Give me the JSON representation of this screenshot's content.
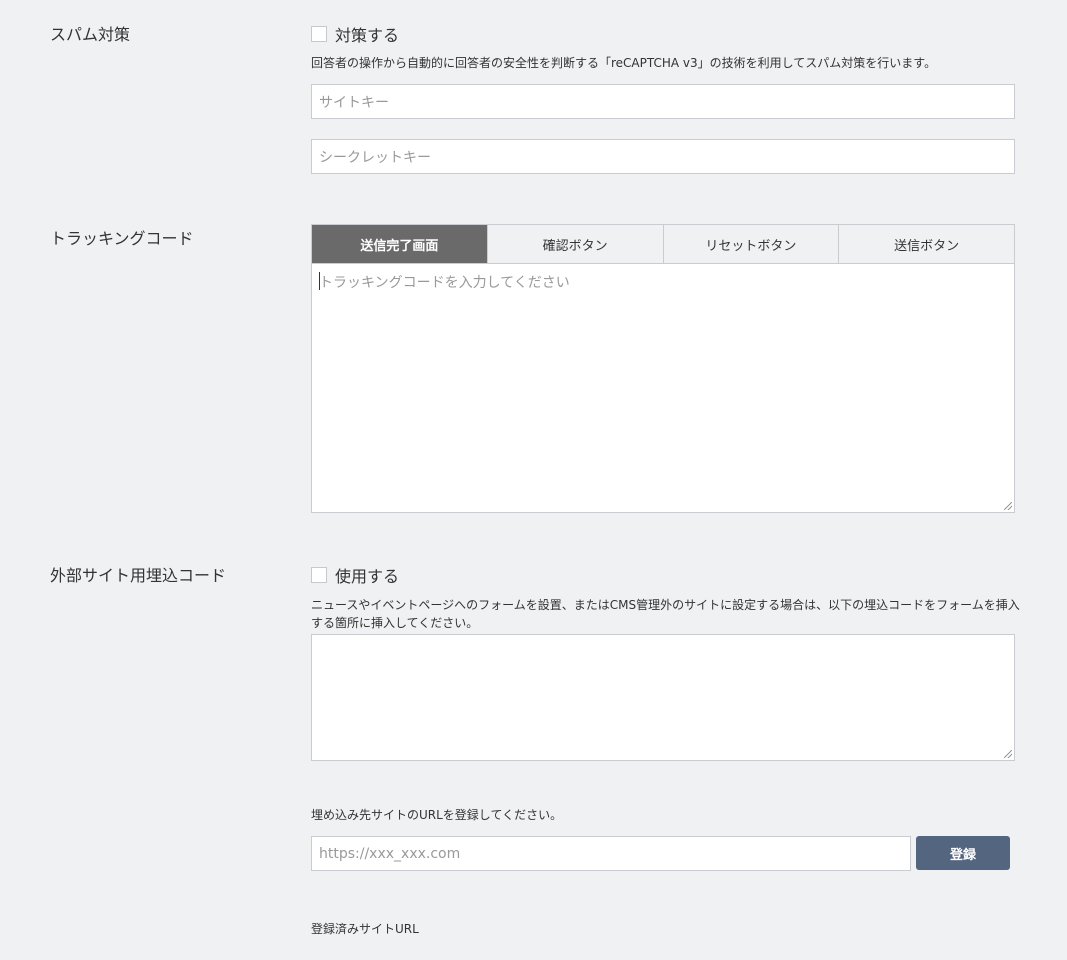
{
  "spam": {
    "label": "スパム対策",
    "checkbox_label": "対策する",
    "description": "回答者の操作から自動的に回答者の安全性を判断する「reCAPTCHA v3」の技術を利用してスパム対策を行います。",
    "site_key_placeholder": "サイトキー",
    "secret_key_placeholder": "シークレットキー"
  },
  "tracking": {
    "label": "トラッキングコード",
    "tabs": [
      "送信完了画面",
      "確認ボタン",
      "リセットボタン",
      "送信ボタン"
    ],
    "active_tab": 0,
    "placeholder": "トラッキングコードを入力してください"
  },
  "embed": {
    "label": "外部サイト用埋込コード",
    "checkbox_label": "使用する",
    "description": "ニュースやイベントページへのフォームを設置、またはCMS管理外のサイトに設定する場合は、以下の埋込コードをフォームを挿入する箇所に挿入してください。",
    "url_instruction": "埋め込み先サイトのURLを登録してください。",
    "url_placeholder": "https://xxx_xxx.com",
    "register_button": "登録",
    "registered_label": "登録済みサイトURL"
  }
}
